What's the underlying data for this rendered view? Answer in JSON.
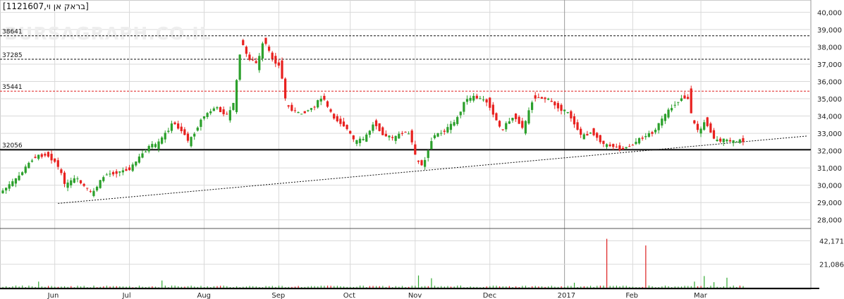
{
  "header": {
    "instrument_label": "[בראק אן וי,1121607]",
    "watermark": "BURSAGRAPH.CO.IL"
  },
  "colors": {
    "up": "#2ca02c",
    "down": "#e8211f",
    "volume": "#33aa33",
    "volume_spike": "#dd2222",
    "grid": "#d9d9d9",
    "resistance": "#e02020",
    "level": "#111111"
  },
  "chart_data": [
    {
      "type": "candlestick",
      "title": "",
      "x_ticks": [
        "Jun",
        "Jul",
        "Aug",
        "Sep",
        "Oct",
        "Nov",
        "Dec",
        "2017",
        "Feb",
        "Mar"
      ],
      "y_ticks": [
        "40,000",
        "39,000",
        "38,000",
        "37,000",
        "36,000",
        "35,000",
        "34,000",
        "33,000",
        "32,000",
        "31,000",
        "30,000",
        "29,000",
        "28,000"
      ],
      "ylim": [
        27500,
        40300
      ],
      "x_domain": [
        0,
        248
      ],
      "month_starts": [
        16,
        39,
        62,
        85,
        107,
        127,
        150,
        173,
        194,
        215
      ],
      "levels": [
        {
          "label": "38641",
          "value": 38641,
          "style": "dashed",
          "color": "#111111"
        },
        {
          "label": "37285",
          "value": 37285,
          "style": "dashed",
          "color": "#111111"
        },
        {
          "label": "35441",
          "value": 35441,
          "style": "dashed",
          "color": "#e02020"
        },
        {
          "label": "32056",
          "value": 32056,
          "style": "solid",
          "color": "#111111"
        }
      ],
      "trendlines": [
        {
          "x0": 17,
          "y0": 28950,
          "x1": 248,
          "y1": 32850,
          "style": "dotted"
        }
      ],
      "price_path": [
        [
          0,
          29600
        ],
        [
          5,
          30400
        ],
        [
          10,
          31600
        ],
        [
          14,
          31800
        ],
        [
          17,
          31300
        ],
        [
          20,
          30000
        ],
        [
          23,
          30400
        ],
        [
          28,
          29500
        ],
        [
          32,
          30600
        ],
        [
          37,
          30800
        ],
        [
          40,
          31000
        ],
        [
          43,
          31700
        ],
        [
          46,
          32300
        ],
        [
          48,
          32300
        ],
        [
          53,
          33600
        ],
        [
          56,
          33100
        ],
        [
          58,
          32500
        ],
        [
          62,
          33900
        ],
        [
          66,
          34500
        ],
        [
          70,
          34000
        ],
        [
          72,
          35000
        ],
        [
          74,
          38300
        ],
        [
          76,
          37400
        ],
        [
          79,
          37000
        ],
        [
          81,
          38400
        ],
        [
          83,
          37500
        ],
        [
          86,
          36800
        ],
        [
          88,
          34600
        ],
        [
          92,
          34100
        ],
        [
          96,
          34500
        ],
        [
          99,
          35100
        ],
        [
          102,
          34000
        ],
        [
          106,
          33400
        ],
        [
          109,
          32500
        ],
        [
          112,
          32700
        ],
        [
          115,
          33600
        ],
        [
          118,
          32900
        ],
        [
          121,
          32700
        ],
        [
          124,
          33100
        ],
        [
          126,
          32900
        ],
        [
          128,
          31400
        ],
        [
          130,
          31200
        ],
        [
          133,
          32800
        ],
        [
          137,
          33200
        ],
        [
          140,
          33700
        ],
        [
          143,
          34900
        ],
        [
          146,
          35100
        ],
        [
          150,
          34800
        ],
        [
          154,
          33200
        ],
        [
          158,
          34000
        ],
        [
          161,
          33300
        ],
        [
          164,
          35100
        ],
        [
          168,
          35000
        ],
        [
          171,
          34600
        ],
        [
          175,
          34100
        ],
        [
          179,
          32800
        ],
        [
          182,
          33100
        ],
        [
          186,
          32300
        ],
        [
          188,
          32300
        ],
        [
          191,
          32100
        ],
        [
          194,
          32300
        ],
        [
          197,
          32700
        ],
        [
          201,
          33100
        ],
        [
          204,
          33900
        ],
        [
          207,
          34600
        ],
        [
          210,
          35100
        ],
        [
          212,
          35000
        ],
        [
          213,
          33700
        ],
        [
          215,
          33100
        ],
        [
          217,
          33700
        ],
        [
          220,
          32600
        ],
        [
          223,
          32600
        ],
        [
          226,
          32500
        ],
        [
          228,
          32600
        ]
      ],
      "volume": {
        "yticks": [
          "42,171",
          "21,086"
        ],
        "max": 52000,
        "spikes": [
          {
            "x": 186,
            "value": 44000
          },
          {
            "x": 198,
            "value": 38000
          }
        ],
        "tall_bars": [
          {
            "x": 11,
            "value": 5500
          },
          {
            "x": 49,
            "value": 6500
          },
          {
            "x": 128,
            "value": 11000
          },
          {
            "x": 132,
            "value": 8500
          },
          {
            "x": 176,
            "value": 4500
          },
          {
            "x": 213,
            "value": 5500
          },
          {
            "x": 216,
            "value": 10500
          },
          {
            "x": 219,
            "value": 5000
          },
          {
            "x": 223,
            "value": 9000
          }
        ]
      }
    }
  ]
}
